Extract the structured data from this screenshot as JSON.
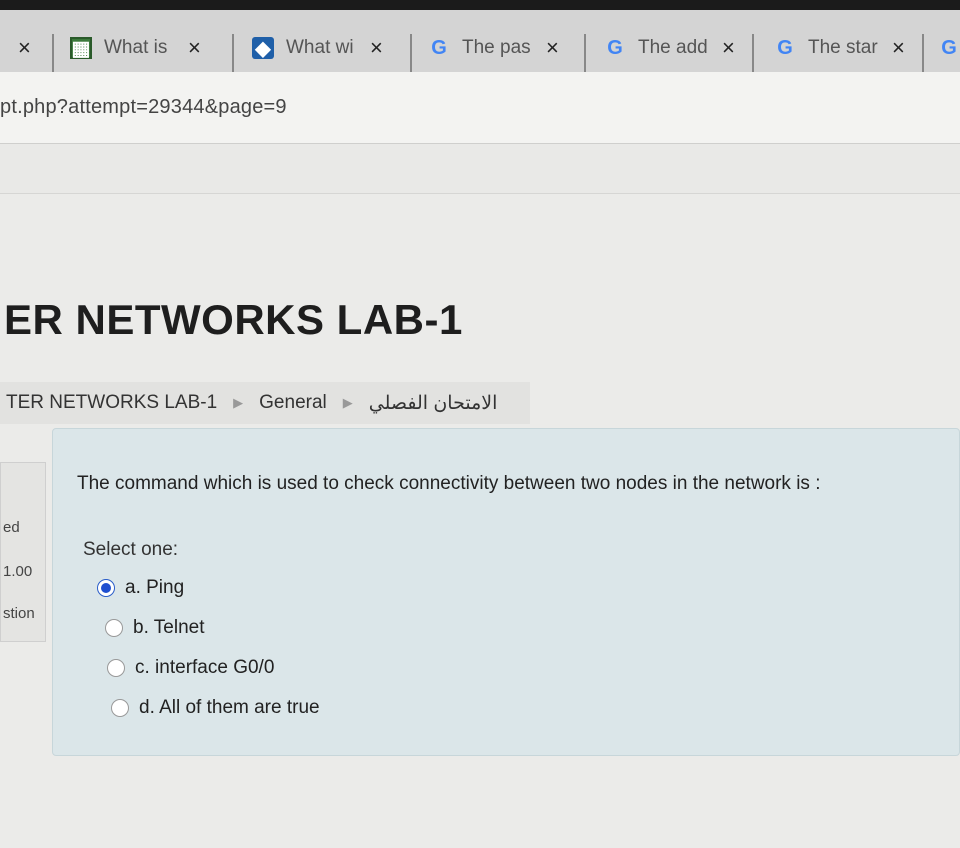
{
  "browser": {
    "tabs": [
      {
        "title": "",
        "icon": "none"
      },
      {
        "title": "What is",
        "icon": "book-icon"
      },
      {
        "title": "What wi",
        "icon": "edu-icon"
      },
      {
        "title": "The pas",
        "icon": "google-icon"
      },
      {
        "title": "The add",
        "icon": "google-icon"
      },
      {
        "title": "The star",
        "icon": "google-icon"
      }
    ],
    "close_glyph": "×",
    "google_glyph": "G",
    "url": "pt.php?attempt=29344&page=9"
  },
  "page": {
    "course_title": "ER NETWORKS LAB-1",
    "breadcrumb": [
      "TER NETWORKS LAB-1",
      "General",
      "الامتحان الفصلي"
    ],
    "breadcrumb_separator": "▶"
  },
  "question_info": {
    "status": "ed",
    "marks": "1.00",
    "flag": "stion"
  },
  "question": {
    "text": "The command which is used to check connectivity  between two nodes in the network is :",
    "prompt": "Select one:",
    "options": [
      {
        "label": "a. Ping",
        "selected": true
      },
      {
        "label": "b. Telnet",
        "selected": false
      },
      {
        "label": "c. interface G0/0",
        "selected": false
      },
      {
        "label": "d. All of them are true",
        "selected": false
      }
    ]
  },
  "colors": {
    "question_bg": "#dbe6e9",
    "radio_selected": "#1f4fd0"
  }
}
